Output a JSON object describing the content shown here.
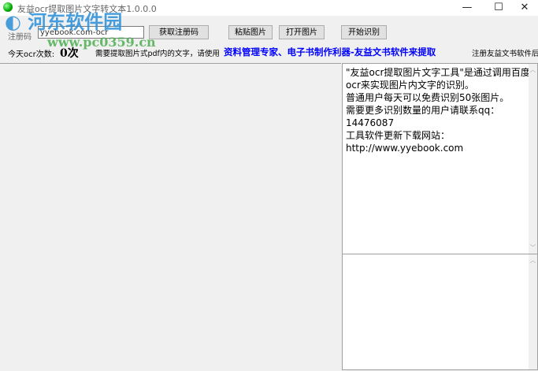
{
  "window": {
    "title": "友益ocr提取图片文字转文本1.0.0.0",
    "minimize": "—",
    "maximize": "☐",
    "close": "✕"
  },
  "watermark": {
    "name": "河东软件园",
    "url": "www.pc0359.cn"
  },
  "toolbar": {
    "reg_label": "注册码",
    "reg_value": "yyebook.com-ocr",
    "get_code": "获取注册码",
    "paste": "粘贴图片",
    "open": "打开图片",
    "start": "开始识别"
  },
  "status": {
    "count_label": "今天ocr次数:",
    "count_value": "0次",
    "hint": "需要提取图片式pdf内的文字，请使用",
    "link": "资料管理专家、电子书制作利器-友益文书软件来提取",
    "register": "注册友益文书软件后"
  },
  "info_text": "\"友益ocr提取图片文字工具\"是通过调用百度ocr来实现图片内文字的识别。\n普通用户每天可以免费识别50张图片。\n需要更多识别数量的用户请联系qq：\n14476087\n工具软件更新下载网站：\nhttp://www.yyebook.com"
}
